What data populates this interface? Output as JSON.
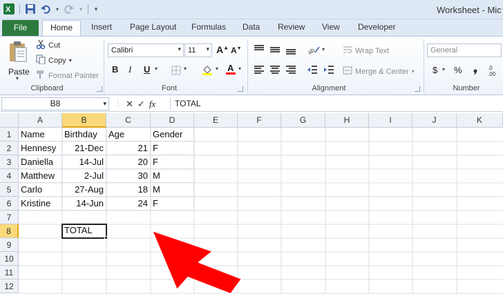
{
  "window": {
    "title": "Worksheet - Mic"
  },
  "ribbon_tabs": [
    "File",
    "Home",
    "Insert",
    "Page Layout",
    "Formulas",
    "Data",
    "Review",
    "View",
    "Developer"
  ],
  "clipboard": {
    "paste_label": "Paste",
    "cut_label": "Cut",
    "copy_label": "Copy",
    "format_painter_label": "Format Painter",
    "group_label": "Clipboard"
  },
  "font": {
    "name": "Calibri",
    "size": "11",
    "bold": "B",
    "italic": "I",
    "underline": "U",
    "group_label": "Font"
  },
  "alignment": {
    "wrap_text_label": "Wrap Text",
    "merge_center_label": "Merge & Center",
    "group_label": "Alignment"
  },
  "number": {
    "format": "General",
    "currency_symbol": "$",
    "percent_symbol": "%",
    "group_label": "Number"
  },
  "formula_bar": {
    "name_box": "B8",
    "fx_label": "fx",
    "content": "TOTAL"
  },
  "grid": {
    "columns": [
      "A",
      "B",
      "C",
      "D",
      "E",
      "F",
      "G",
      "H",
      "I",
      "J",
      "K"
    ],
    "rows": [
      "1",
      "2",
      "3",
      "4",
      "5",
      "6",
      "7",
      "8",
      "9",
      "10",
      "11",
      "12"
    ],
    "selected_column": "B",
    "selected_row": "8",
    "headers": {
      "name": "Name",
      "birthday": "Birthday",
      "age": "Age",
      "gender": "Gender"
    },
    "records": [
      {
        "name": "Hennesy",
        "birthday": "21-Dec",
        "age": "21",
        "gender": "F"
      },
      {
        "name": "Daniella",
        "birthday": "14-Jul",
        "age": "20",
        "gender": "F"
      },
      {
        "name": "Matthew",
        "birthday": "2-Jul",
        "age": "30",
        "gender": "M"
      },
      {
        "name": "Carlo",
        "birthday": "27-Aug",
        "age": "18",
        "gender": "M"
      },
      {
        "name": "Kristine",
        "birthday": "14-Jun",
        "age": "24",
        "gender": "F"
      }
    ],
    "active_cell_value": "TOTAL"
  },
  "colors": {
    "file_tab": "#2c7a3f",
    "selected_header": "#f9d97a",
    "annotation_arrow": "#ff0000"
  }
}
